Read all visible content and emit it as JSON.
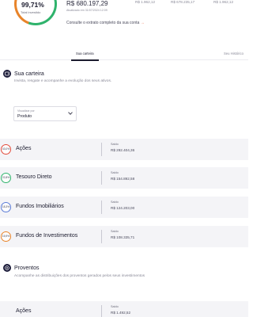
{
  "summary": {
    "percent": "99,71%",
    "percent_sublabel": "Total investido",
    "total_value": "R$ 680.197,29",
    "updated": "Atualizado em 31/07/2024 12:09",
    "stats": [
      "R$ 1.962,12",
      "R$ 678.235,17",
      "R$ 1.962,12"
    ],
    "extrato_link": "Consulte o extrato completo da sua conta",
    "extrato_arrow": "→"
  },
  "tabs": [
    {
      "label": "Sua carteira"
    },
    {
      "label": "Seu Histórico"
    }
  ],
  "carteira": {
    "title": "Sua carteira",
    "description": "Invista, resgate e acompanhe a evolução dos seus ativos."
  },
  "filter": {
    "label": "Visualizar por",
    "value": "Produto"
  },
  "assets": [
    {
      "percent": "43,0%",
      "name": "Ações",
      "saldo_label": "Saldo",
      "saldo": "R$ 292.404,36"
    },
    {
      "percent": "22,8%",
      "name": "Tesouro Direto",
      "saldo_label": "Saldo",
      "saldo": "R$ 154.892,58"
    },
    {
      "percent": "18,3%",
      "name": "Fundos Imobiliários",
      "saldo_label": "Saldo",
      "saldo": "R$ 124.203,00"
    },
    {
      "percent": "15,9%",
      "name": "Fundos de Investimentos",
      "saldo_label": "Saldo",
      "saldo": "R$ 108.335,71"
    }
  ],
  "proventos": {
    "title": "Proventos",
    "description": "Acompanhe as distribuições dos proventos gerados pelos seus investimentos",
    "rows": [
      {
        "name": "Ações",
        "saldo_label": "Saldo",
        "saldo": "R$ 1.492,52"
      }
    ]
  },
  "icons": {
    "carteira": "wallet-icon",
    "proventos": "coins-icon",
    "chevron": "chevron-down-icon"
  },
  "colors": {
    "donut_green": "#2fb36c",
    "donut_orange": "#e8842a",
    "donut_red": "#e24b3b",
    "link_arrow": "#e6532b",
    "section_icon_bg": "#1c1c3a",
    "row_bg": "#f4f4f7"
  }
}
